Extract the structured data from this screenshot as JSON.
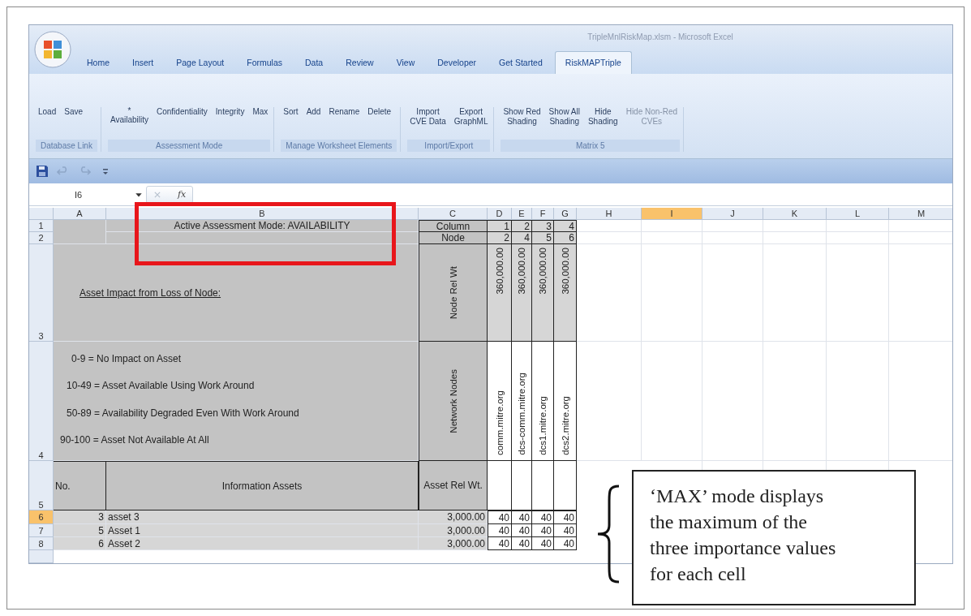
{
  "window": {
    "title": "TripleMnlRiskMap.xlsm - Microsoft Excel"
  },
  "tabs": [
    {
      "label": "Home",
      "selected": false
    },
    {
      "label": "Insert",
      "selected": false
    },
    {
      "label": "Page Layout",
      "selected": false
    },
    {
      "label": "Formulas",
      "selected": false
    },
    {
      "label": "Data",
      "selected": false
    },
    {
      "label": "Review",
      "selected": false
    },
    {
      "label": "View",
      "selected": false
    },
    {
      "label": "Developer",
      "selected": false
    },
    {
      "label": "Get Started",
      "selected": false
    },
    {
      "label": "RiskMAPTriple",
      "selected": true
    }
  ],
  "ribbon": {
    "groups": [
      {
        "label": "Database Link",
        "buttons": [
          {
            "label": "Load",
            "disabled": false
          },
          {
            "label": "Save",
            "disabled": false
          }
        ]
      },
      {
        "label": "Assessment Mode",
        "buttons": [
          {
            "label": "Availability",
            "marker": "*",
            "disabled": false
          },
          {
            "label": "Confidentiality",
            "disabled": false
          },
          {
            "label": "Integrity",
            "disabled": false
          },
          {
            "label": "Max",
            "disabled": false
          }
        ]
      },
      {
        "label": "Manage Worksheet Elements",
        "buttons": [
          {
            "label": "Sort",
            "disabled": false
          },
          {
            "label": "Add",
            "disabled": false
          },
          {
            "label": "Rename",
            "disabled": false
          },
          {
            "label": "Delete",
            "disabled": false
          }
        ]
      },
      {
        "label": "Import/Export",
        "buttons": [
          {
            "label": "Import\nCVE Data",
            "disabled": false
          },
          {
            "label": "Export\nGraphML",
            "disabled": false
          }
        ]
      },
      {
        "label": "Matrix 5",
        "buttons": [
          {
            "label": "Show Red\nShading",
            "disabled": false
          },
          {
            "label": "Show All\nShading",
            "disabled": false
          },
          {
            "label": "Hide\nShading",
            "disabled": false
          },
          {
            "label": "Hide Non-Red\nCVEs",
            "disabled": true
          }
        ]
      }
    ]
  },
  "formula_bar": {
    "name_box": "I6",
    "function_label": "fx"
  },
  "sheet": {
    "columns": [
      {
        "label": "A",
        "selected": false
      },
      {
        "label": "B",
        "selected": false
      },
      {
        "label": "C",
        "selected": false
      },
      {
        "label": "D",
        "selected": false
      },
      {
        "label": "E",
        "selected": false
      },
      {
        "label": "F",
        "selected": false
      },
      {
        "label": "G",
        "selected": false
      },
      {
        "label": "H",
        "selected": false
      },
      {
        "label": "I",
        "selected": true
      },
      {
        "label": "J",
        "selected": false
      },
      {
        "label": "K",
        "selected": false
      },
      {
        "label": "L",
        "selected": false
      },
      {
        "label": "M",
        "selected": false
      }
    ],
    "rows": [
      {
        "label": "1",
        "selected": false
      },
      {
        "label": "2",
        "selected": false
      },
      {
        "label": "3",
        "selected": false
      },
      {
        "label": "4",
        "selected": false
      },
      {
        "label": "5",
        "selected": false
      },
      {
        "label": "6",
        "selected": true
      },
      {
        "label": "7",
        "selected": false
      },
      {
        "label": "8",
        "selected": false
      }
    ],
    "mode_title": "Active Assessment Mode: AVAILABILITY",
    "impact_heading": "Asset Impact from Loss of Node:",
    "legend": [
      "0-9 = No Impact on Asset",
      "10-49 = Asset Available Using Work Around",
      "50-89 = Availability Degraded Even With Work Around",
      "90-100 = Asset Not Available At All"
    ],
    "column_label": "Column",
    "node_label": "Node",
    "node_rel_wt_label": "Node Rel Wt",
    "network_nodes_label": "Network Nodes",
    "nodes": [
      {
        "column": "1",
        "node": "2",
        "rel_wt": "360,000.00",
        "name": "comm.mitre.org"
      },
      {
        "column": "2",
        "node": "4",
        "rel_wt": "360,000.00",
        "name": "dcs-comm.mitre.org"
      },
      {
        "column": "3",
        "node": "5",
        "rel_wt": "360,000.00",
        "name": "dcs1.mitre.org"
      },
      {
        "column": "4",
        "node": "6",
        "rel_wt": "360,000.00",
        "name": "dcs2.mitre.org"
      }
    ],
    "headers": {
      "no": "No.",
      "assets": "Information Assets",
      "rel_wt": "Asset Rel Wt."
    },
    "assets": [
      {
        "no": "3",
        "name": "asset 3",
        "rel_wt": "3,000.00",
        "values": [
          "40",
          "40",
          "40",
          "40"
        ]
      },
      {
        "no": "5",
        "name": "Asset 1",
        "rel_wt": "3,000.00",
        "values": [
          "40",
          "40",
          "40",
          "40"
        ]
      },
      {
        "no": "6",
        "name": "Asset 2",
        "rel_wt": "3,000.00",
        "values": [
          "40",
          "40",
          "40",
          "40"
        ]
      }
    ]
  },
  "callout": {
    "lines": [
      "‘MAX’ mode displays",
      "the maximum of the",
      "three importance values",
      "for each cell"
    ]
  }
}
